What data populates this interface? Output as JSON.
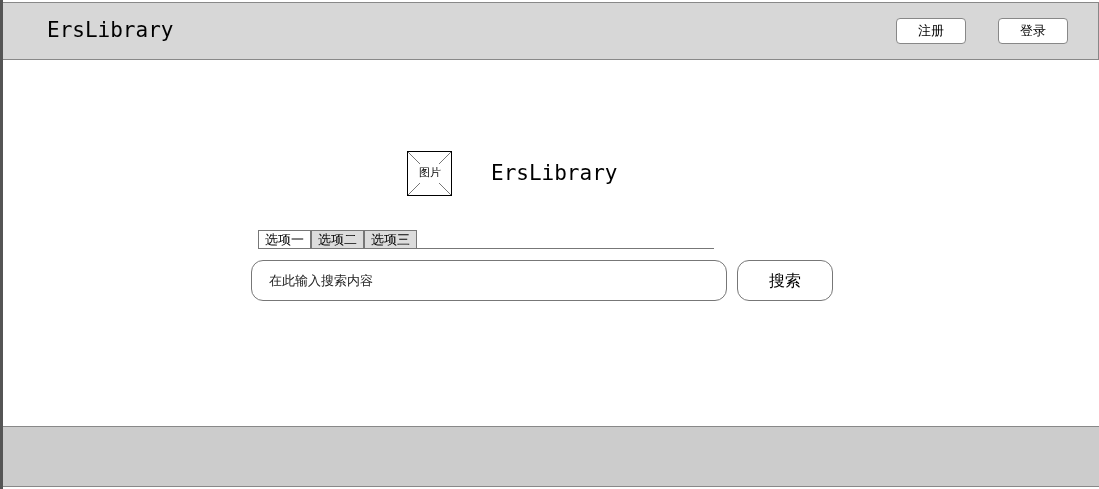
{
  "header": {
    "title": "ErsLibrary",
    "buttons": [
      "注册",
      "登录"
    ]
  },
  "logo": {
    "image_label": "图片",
    "title": "ErsLibrary"
  },
  "tabs": [
    {
      "label": "选项一",
      "selected": true
    },
    {
      "label": "选项二",
      "selected": false
    },
    {
      "label": "选项三",
      "selected": false
    }
  ],
  "search": {
    "placeholder": "在此输入搜索内容",
    "button": "搜索"
  }
}
